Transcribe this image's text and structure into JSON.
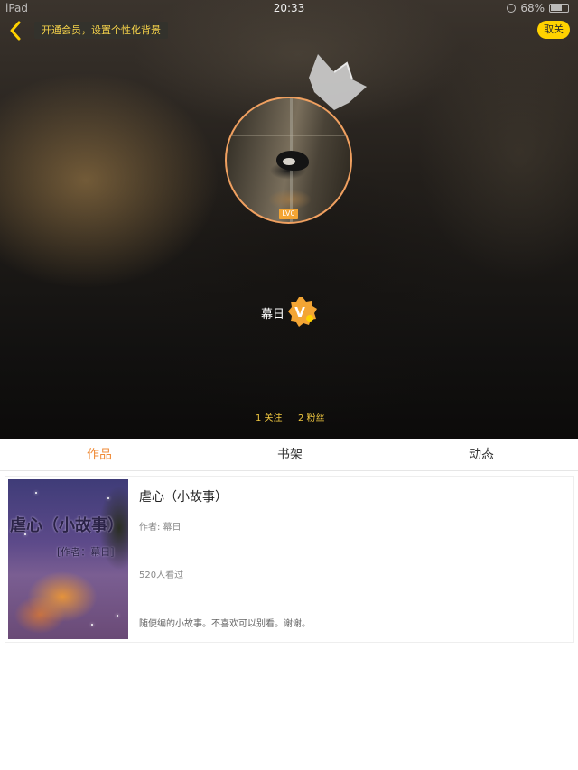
{
  "status_bar": {
    "device": "iPad",
    "time": "20:33",
    "battery": "68%"
  },
  "header": {
    "vip_banner": "开通会员，设置个性化背景",
    "unfollow_label": "取关"
  },
  "profile": {
    "username": "幕日",
    "avatar_tag": "LV0",
    "badge_letter": "V",
    "badge_color": "#f3a534",
    "follow_count": "1 关注",
    "fans_count": "2 粉丝"
  },
  "tabs": [
    {
      "label": "作品",
      "active": true
    },
    {
      "label": "书架",
      "active": false
    },
    {
      "label": "动态",
      "active": false
    }
  ],
  "colors": {
    "accent": "#ef8b38",
    "stat_text": "#f1c840",
    "unfollow_bg": "#ffd200"
  },
  "book": {
    "title": "虐心（小故事）",
    "cover_title": "虐心（小故事）",
    "cover_author": "[作者：幕日]",
    "author": "作者: 幕日",
    "views": "520人看过",
    "description": "随便编的小故事。不喜欢可以别看。谢谢。"
  }
}
